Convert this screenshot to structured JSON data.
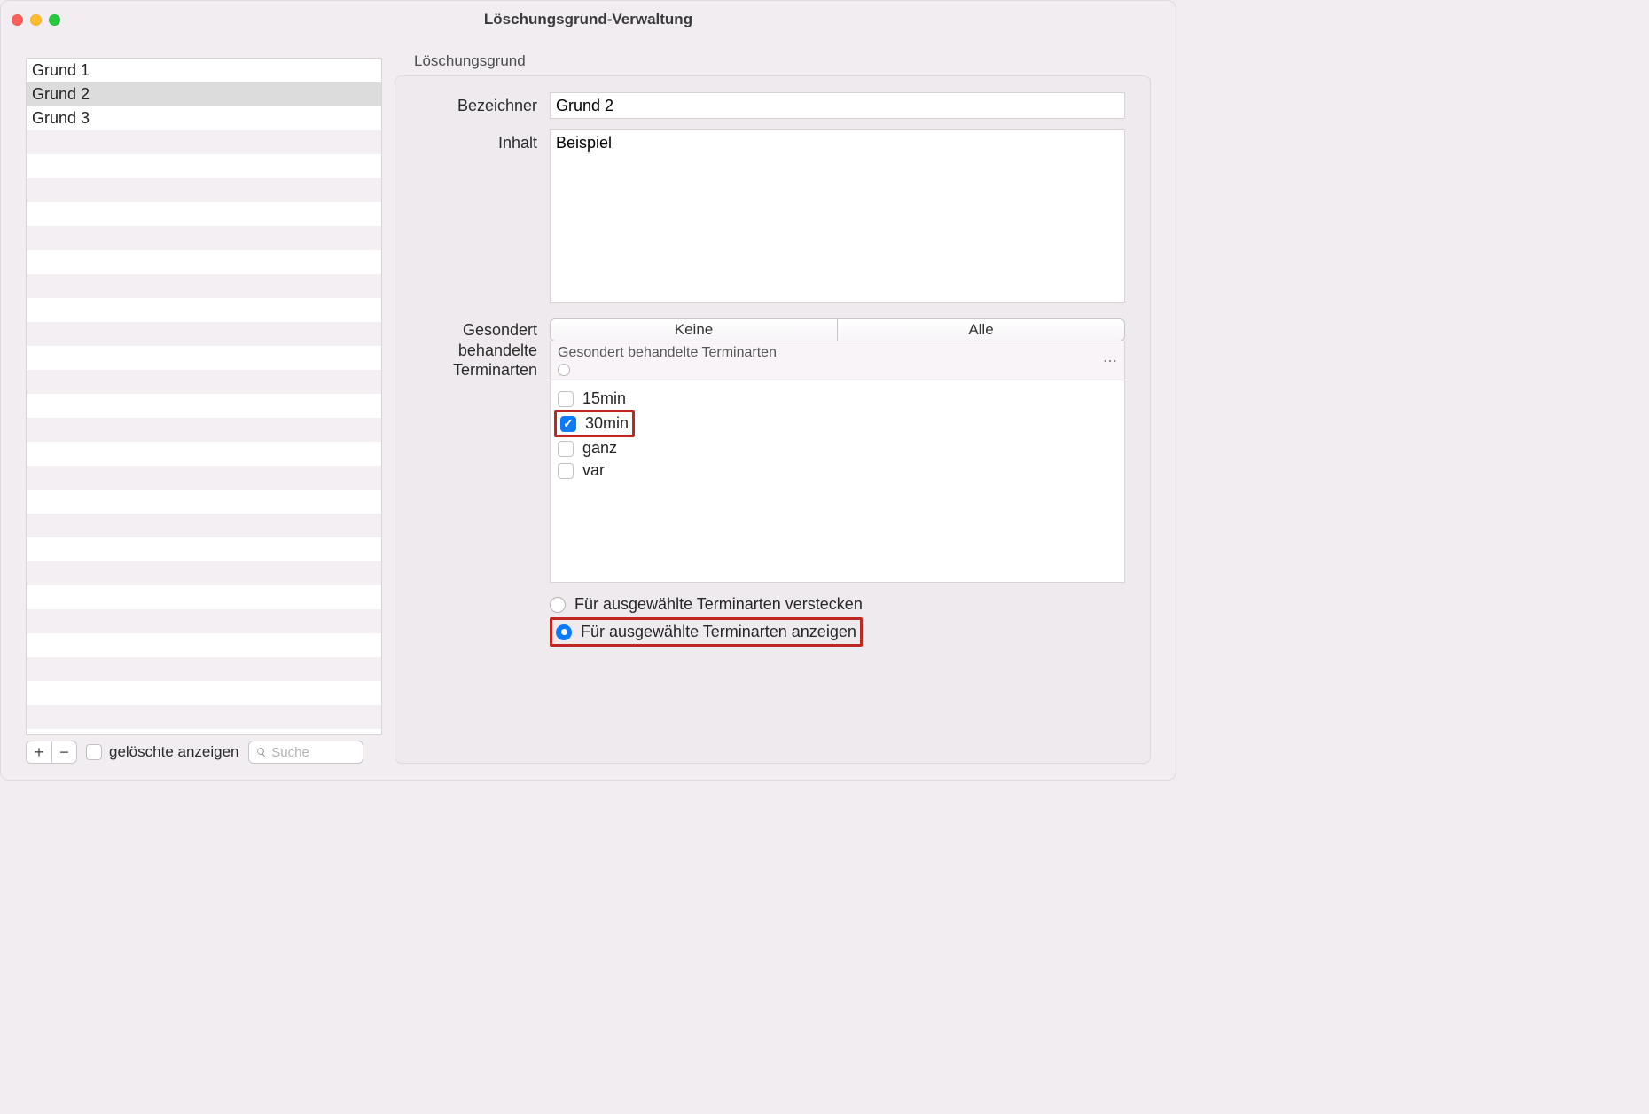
{
  "window": {
    "title": "Löschungsgrund-Verwaltung"
  },
  "sidebar": {
    "items": [
      "Grund 1",
      "Grund 2",
      "Grund 3"
    ],
    "selected_index": 1,
    "total_slots": 28
  },
  "footer": {
    "add_tooltip": "+",
    "remove_tooltip": "−",
    "show_deleted_label": "gelöschte anzeigen",
    "show_deleted_checked": false,
    "search_placeholder": "Suche"
  },
  "detail": {
    "group_title": "Löschungsgrund",
    "labels": {
      "bezeichner": "Bezeichner",
      "inhalt": "Inhalt",
      "terminarten": "Gesondert behandelte Terminarten"
    },
    "bezeichner_value": "Grund 2",
    "inhalt_value": "Beispiel",
    "segmented": {
      "none": "Keine",
      "all": "Alle"
    },
    "filter_header": "Gesondert behandelte Terminarten",
    "terminart_options": [
      {
        "label": "15min",
        "checked": false,
        "highlight": false
      },
      {
        "label": "30min",
        "checked": true,
        "highlight": true
      },
      {
        "label": "ganz",
        "checked": false,
        "highlight": false
      },
      {
        "label": "var",
        "checked": false,
        "highlight": false
      }
    ],
    "radio": {
      "hide_label": "Für ausgewählte Terminarten verstecken",
      "show_label": "Für ausgewählte Terminarten anzeigen",
      "selected": "show",
      "highlight_show": true
    }
  },
  "icons": {
    "plus": "+",
    "minus": "−",
    "check": "✓",
    "more": "⋯"
  }
}
